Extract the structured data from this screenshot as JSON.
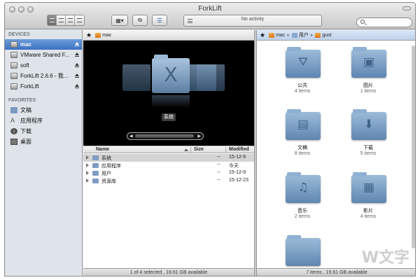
{
  "window": {
    "title": "ForkLift"
  },
  "toolbar": {
    "activity_text": "No activity",
    "view_modes": [
      "icons-view-icon",
      "list-view-icon",
      "columns-view-icon",
      "coverflow-view-icon"
    ],
    "active_view": 0,
    "icons": [
      "action-menu-icon",
      "sync-browsing-icon",
      "favorites-icon",
      "search-icon",
      "activity-menu-icon"
    ]
  },
  "sidebar": {
    "devices_header": "DEVICES",
    "devices": [
      {
        "label": "mac",
        "selected": true,
        "eject": true
      },
      {
        "label": "VMware Shared F...",
        "selected": false,
        "eject": true
      },
      {
        "label": "soft",
        "selected": false,
        "eject": true
      },
      {
        "label": "ForkLift 2.6.6 - 我...",
        "selected": false,
        "eject": true
      },
      {
        "label": "ForkLift",
        "selected": false,
        "eject": true
      }
    ],
    "favorites_header": "FAVORITES",
    "favorites": [
      {
        "label": "文稿",
        "icon": "documents-icon"
      },
      {
        "label": "应用程序",
        "icon": "applications-icon"
      },
      {
        "label": "下载",
        "icon": "downloads-icon"
      },
      {
        "label": "桌面",
        "icon": "desktop-icon"
      }
    ]
  },
  "left_pane": {
    "path": [
      "mac"
    ],
    "preview_label": "系统",
    "preview_glyph": "X",
    "columns": {
      "name": "Name",
      "size": "Size",
      "modified": "Modified"
    },
    "rows": [
      {
        "name": "系统",
        "size": "--",
        "modified": "15-12-9",
        "selected": true
      },
      {
        "name": "应用程序",
        "size": "--",
        "modified": "今天",
        "selected": false
      },
      {
        "name": "用户",
        "size": "--",
        "modified": "15-12-9",
        "selected": false
      },
      {
        "name": "资源库",
        "size": "--",
        "modified": "15-12-23",
        "selected": false
      }
    ],
    "status": "1 of 4 selected , 19.61 GB available"
  },
  "right_pane": {
    "path": [
      "mac",
      "用户",
      "gust"
    ],
    "items": [
      {
        "name": "公共",
        "count": "4 items",
        "glyph": "⛛"
      },
      {
        "name": "图片",
        "count": "1 items",
        "glyph": "▣"
      },
      {
        "name": "文稿",
        "count": "8 items",
        "glyph": "▤"
      },
      {
        "name": "下载",
        "count": "5 items",
        "glyph": "⬇"
      },
      {
        "name": "音乐",
        "count": "2 items",
        "glyph": "♫"
      },
      {
        "name": "影片",
        "count": "4 items",
        "glyph": "▦"
      },
      {
        "name": "",
        "count": "",
        "glyph": ""
      }
    ],
    "status": "7 items , 19.61 GB available"
  },
  "watermark": "W文字"
}
